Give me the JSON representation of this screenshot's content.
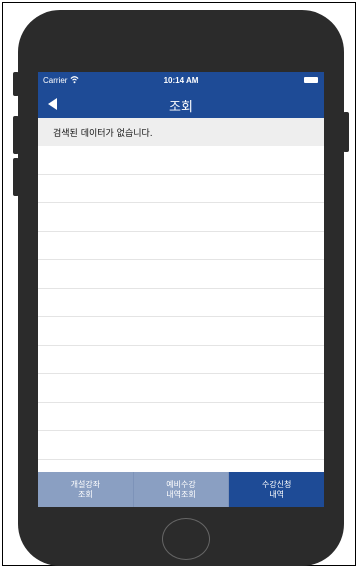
{
  "status_bar": {
    "carrier": "Carrier",
    "time": "10:14 AM"
  },
  "nav": {
    "title": "조회"
  },
  "message": "검색된 데이터가 없습니다.",
  "tabs": [
    {
      "line1": "개설강좌",
      "line2": "조회"
    },
    {
      "line1": "예비수강",
      "line2": "내역조회"
    },
    {
      "line1": "수강신청",
      "line2": "내역"
    }
  ],
  "colors": {
    "accent": "#1e4b96",
    "tab_inactive": "#8a9fc2"
  }
}
